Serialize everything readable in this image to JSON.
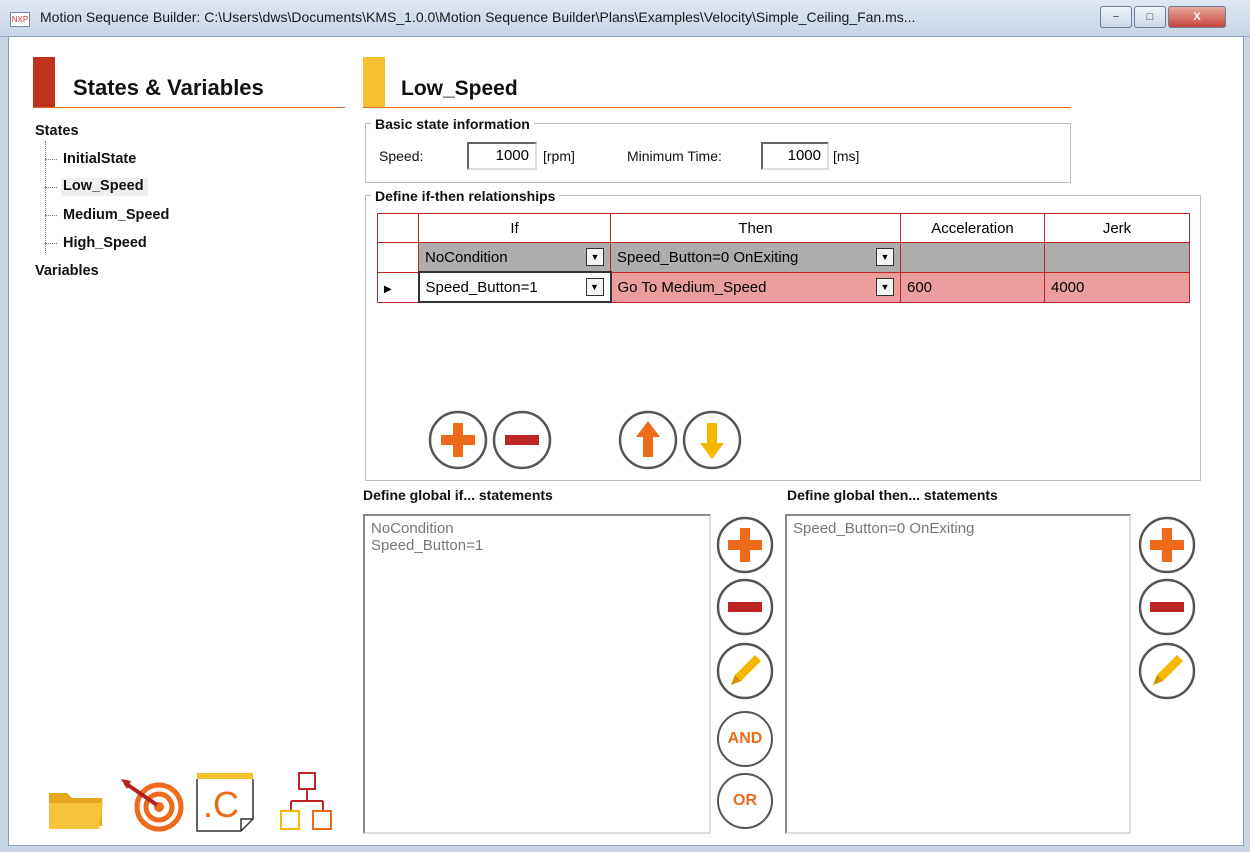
{
  "window": {
    "title": "Motion Sequence Builder: C:\\Users\\dws\\Documents\\KMS_1.0.0\\Motion Sequence Builder\\Plans\\Examples\\Velocity\\Simple_Ceiling_Fan.ms...",
    "app_icon": "NXP",
    "minimize_label": "−",
    "maximize_label": "□",
    "close_label": "X"
  },
  "left_panel": {
    "title": "States & Variables",
    "accent_color": "#c0321e",
    "tree": {
      "states_label": "States",
      "states": [
        "InitialState",
        "Low_Speed",
        "Medium_Speed",
        "High_Speed"
      ],
      "selected": "Low_Speed",
      "variables_label": "Variables"
    },
    "toolbar_icons": [
      "folder-icon",
      "target-icon",
      "c-file-icon",
      "hierarchy-icon"
    ]
  },
  "state_panel": {
    "title": "Low_Speed",
    "accent_color": "#f5c030",
    "basic_info": {
      "group_label": "Basic state information",
      "speed_label": "Speed:",
      "speed_value": "1000",
      "speed_unit": "[rpm]",
      "min_time_label": "Minimum Time:",
      "min_time_value": "1000",
      "min_time_unit": "[ms]"
    },
    "relationships": {
      "group_label": "Define if-then relationships",
      "columns": [
        "If",
        "Then",
        "Acceleration",
        "Jerk"
      ],
      "rows": [
        {
          "if": "NoCondition",
          "then": "Speed_Button=0 OnExiting",
          "acceleration": "",
          "jerk": ""
        },
        {
          "if": "Speed_Button=1",
          "then": "Go To  Medium_Speed",
          "acceleration": "600",
          "jerk": "4000"
        }
      ],
      "row_marker": "▶",
      "buttons": [
        "add-icon",
        "remove-icon",
        "move-up-icon",
        "move-down-icon"
      ]
    }
  },
  "global_if": {
    "label": "Define global if... statements",
    "items": [
      "NoCondition",
      "Speed_Button=1"
    ],
    "and_label": "AND",
    "or_label": "OR"
  },
  "global_then": {
    "label": "Define global then... statements",
    "items": [
      "Speed_Button=0 OnExiting"
    ]
  },
  "colors": {
    "orange": "#f06a1c",
    "red": "#c02525",
    "yellow": "#f5b800",
    "rule": "#e46a2a"
  }
}
